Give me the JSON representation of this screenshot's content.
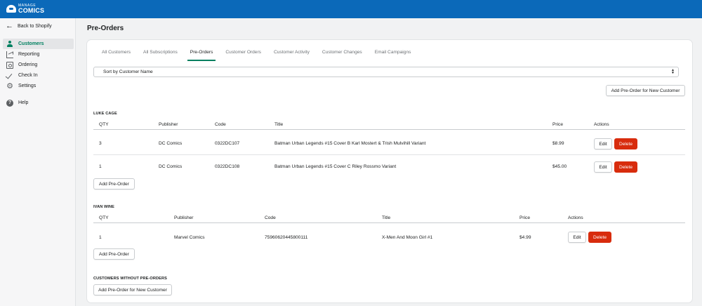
{
  "app": {
    "logo_line1": "MANAGE",
    "logo_line2": "COMICS"
  },
  "sidebar": {
    "back_label": "Back to Shopify",
    "items": [
      {
        "label": "Customers",
        "icon": "user-icon",
        "active": true
      },
      {
        "label": "Reporting",
        "icon": "chart-icon",
        "active": false
      },
      {
        "label": "Ordering",
        "icon": "clipboard-icon",
        "active": false
      },
      {
        "label": "Check In",
        "icon": "checkmark-icon",
        "active": false
      },
      {
        "label": "Settings",
        "icon": "gear-icon",
        "active": false
      },
      {
        "label": "Help",
        "icon": "help-icon",
        "active": false
      }
    ]
  },
  "page": {
    "title": "Pre-Orders"
  },
  "tabs": [
    {
      "label": "All Customers"
    },
    {
      "label": "All Subscriptions"
    },
    {
      "label": "Pre-Orders",
      "active": true
    },
    {
      "label": "Customer Orders"
    },
    {
      "label": "Customer Activity"
    },
    {
      "label": "Customer Changes"
    },
    {
      "label": "Email Campaigns"
    }
  ],
  "sort": {
    "selected": "Sort by Customer Name"
  },
  "add_new_customer_label": "Add Pre-Order for New Customer",
  "columns": {
    "qty": "QTY",
    "publisher": "Publisher",
    "code": "Code",
    "title": "Title",
    "price": "Price",
    "actions": "Actions"
  },
  "customers": [
    {
      "name": "LUKE CAGE",
      "rows": [
        {
          "qty": "3",
          "publisher": "DC Comics",
          "code": "0322DC107",
          "title": "Batman Urban Legends #15 Cover B Karl Mostert & Trish Mulvihill Variant",
          "price": "$8.99"
        },
        {
          "qty": "1",
          "publisher": "DC Comics",
          "code": "0322DC108",
          "title": "Batman Urban Legends #15 Cover C Riley Rossmo Variant",
          "price": "$45.00"
        }
      ]
    },
    {
      "name": "IVAN WINE",
      "rows": [
        {
          "qty": "1",
          "publisher": "Marvel Comics",
          "code": "75960620445800111",
          "title": "X-Men And Moon Girl #1",
          "price": "$4.99"
        }
      ]
    }
  ],
  "buttons": {
    "edit": "Edit",
    "delete": "Delete",
    "add_pre_order": "Add Pre-Order"
  },
  "no_pre_orders": {
    "title": "CUSTOMERS WITHOUT PRE-ORDERS",
    "button": "Add Pre-Order for New Customer"
  },
  "colors": {
    "topbar": "#0b69b9",
    "accent": "#008060",
    "danger": "#d82c0d"
  }
}
